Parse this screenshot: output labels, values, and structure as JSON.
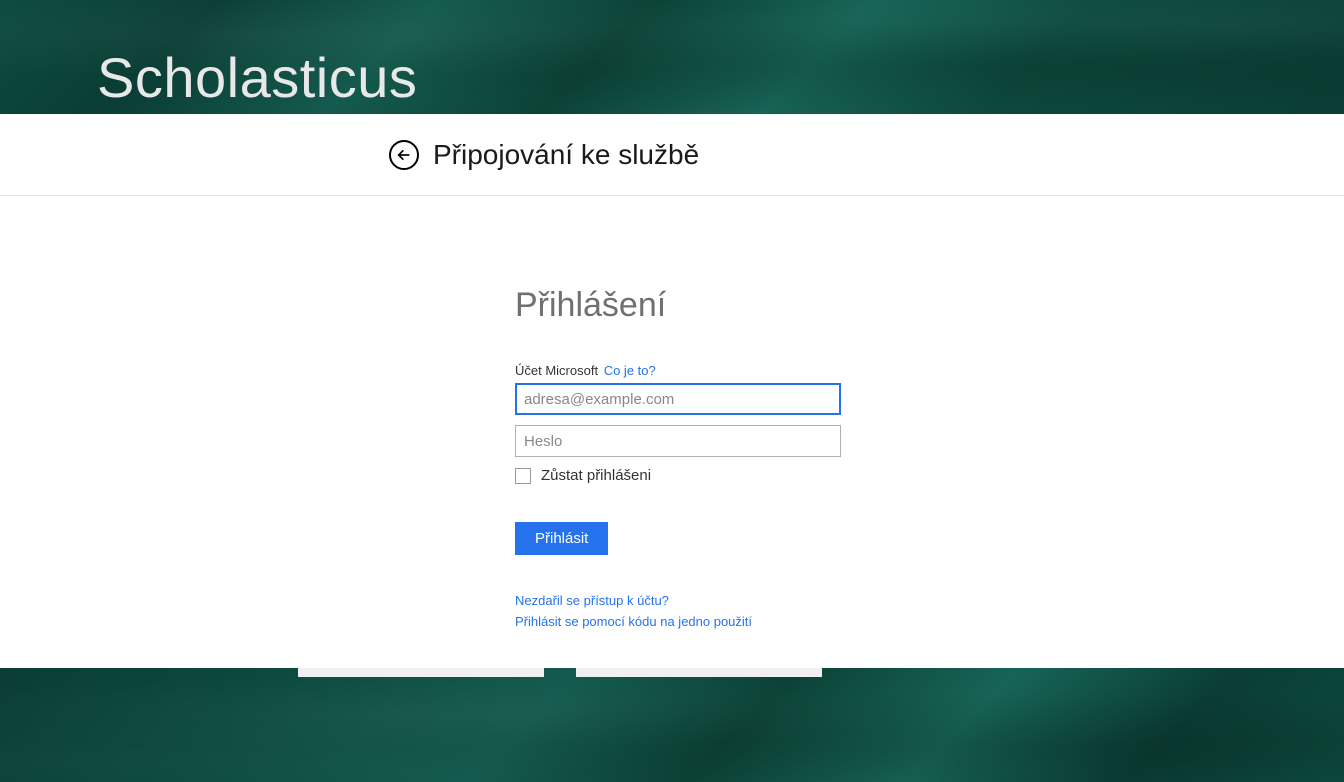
{
  "header": {
    "app_title": "Scholasticus"
  },
  "subheader": {
    "title": "Připojování ke službě"
  },
  "login": {
    "title": "Přihlášení",
    "account_label": "Účet Microsoft",
    "what_is_link": "Co je to?",
    "email_placeholder": "adresa@example.com",
    "password_placeholder": "Heslo",
    "stay_signed_in_label": "Zůstat přihlášeni",
    "signin_button_label": "Přihlásit",
    "cant_access_link": "Nezdařil se přístup k účtu?",
    "single_use_code_link": "Přihlásit se pomocí kódu na jedno použití"
  }
}
